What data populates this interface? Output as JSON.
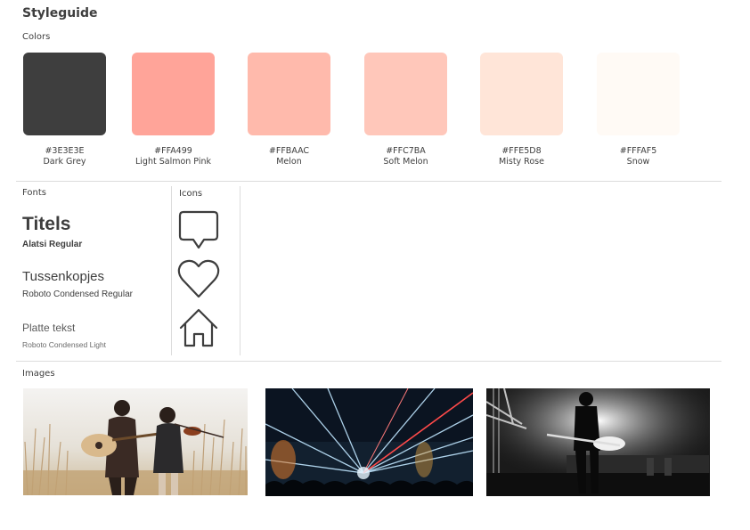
{
  "page": {
    "title": "Styleguide"
  },
  "colors": {
    "label": "Colors",
    "swatches": [
      {
        "hex": "#3E3E3E",
        "name": "Dark Grey"
      },
      {
        "hex": "#FFA499",
        "name": "Light Salmon Pink"
      },
      {
        "hex": "#FFBAAC",
        "name": "Melon"
      },
      {
        "hex": "#FFC7BA",
        "name": "Soft Melon"
      },
      {
        "hex": "#FFE5D8",
        "name": "Misty Rose"
      },
      {
        "hex": "#FFFAF5",
        "name": "Snow"
      }
    ]
  },
  "fonts": {
    "label": "Fonts",
    "items": [
      {
        "sample": "Titels",
        "font_name": "Alatsi Regular"
      },
      {
        "sample": "Tussenkopjes",
        "font_name": "Roboto Condensed Regular"
      },
      {
        "sample": "Platte tekst",
        "font_name": "Roboto Condensed Light"
      }
    ]
  },
  "icons": {
    "label": "Icons",
    "items": [
      "speech-bubble-icon",
      "heart-icon",
      "home-icon"
    ]
  },
  "images": {
    "label": "Images",
    "items": [
      "image-musicians-field",
      "image-concert-lasers",
      "image-guitarist-stage"
    ]
  }
}
